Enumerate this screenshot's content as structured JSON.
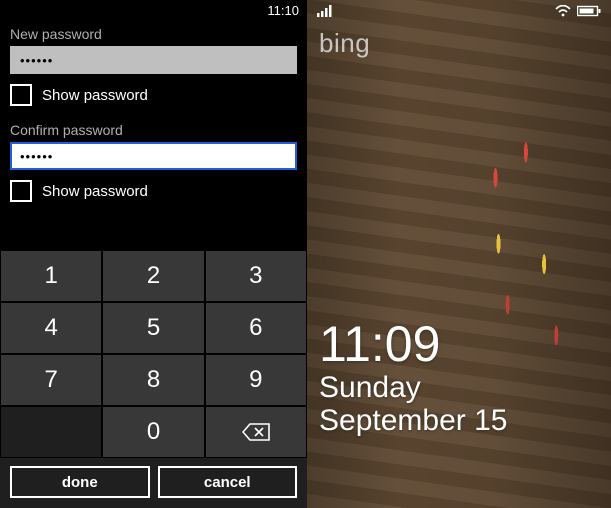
{
  "left": {
    "status_time": "11:10",
    "new_password_label": "New password",
    "new_password_value": "••••••",
    "show_password_label": "Show password",
    "confirm_password_label": "Confirm password",
    "confirm_password_value": "••••••",
    "keypad": {
      "k1": "1",
      "k2": "2",
      "k3": "3",
      "k4": "4",
      "k5": "5",
      "k6": "6",
      "k7": "7",
      "k8": "8",
      "k9": "9",
      "k0": "0"
    },
    "done_label": "done",
    "cancel_label": "cancel"
  },
  "right": {
    "brand": "bing",
    "time": "11:09",
    "day": "Sunday",
    "date": "September 15"
  }
}
